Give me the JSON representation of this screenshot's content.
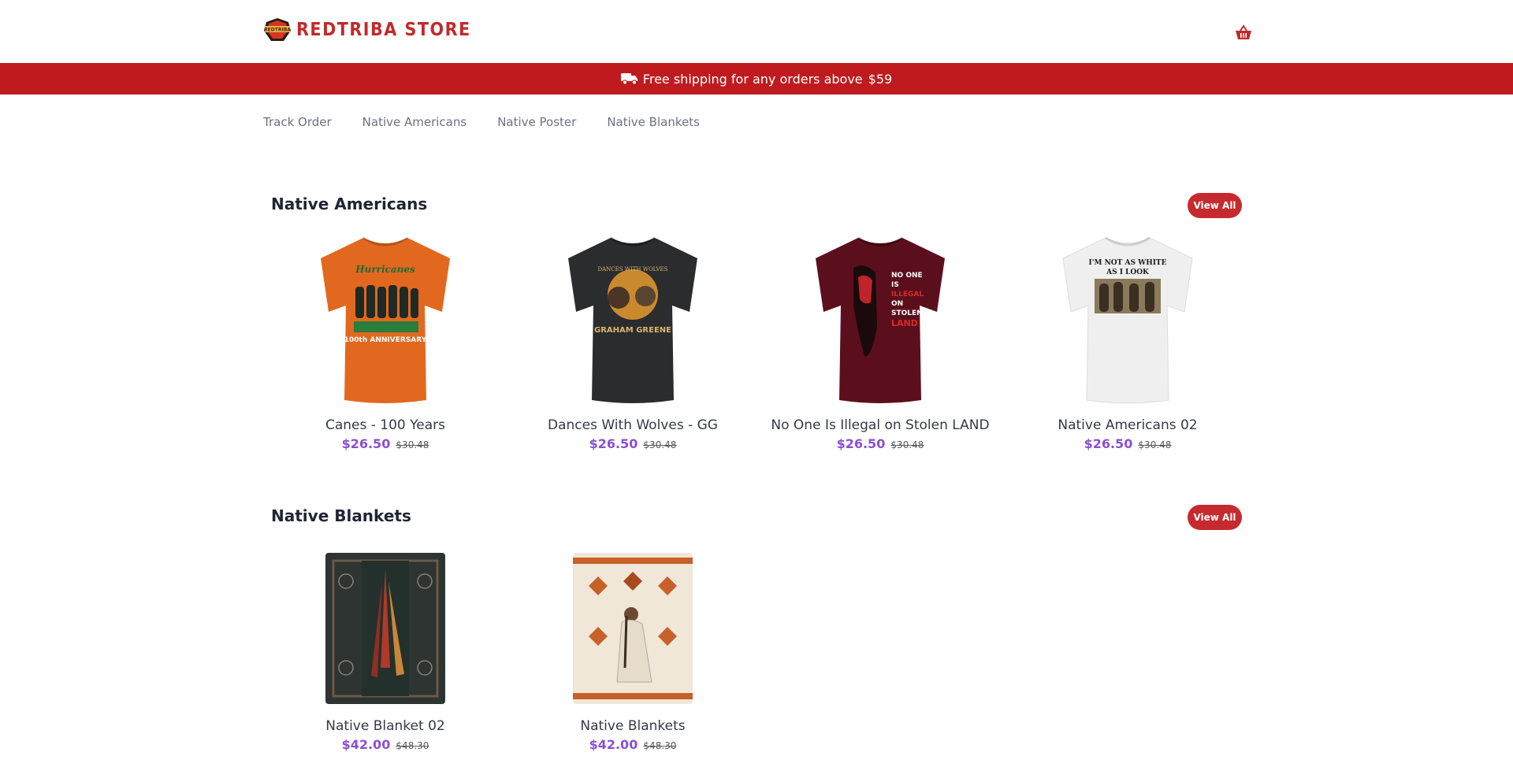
{
  "store": {
    "name": "REDTRIBA STORE",
    "badge_text": "REDTRIBA"
  },
  "banner": {
    "text": "Free shipping for any orders above",
    "amount": "$59"
  },
  "nav": [
    "Track Order",
    "Native Americans",
    "Native Poster",
    "Native Blankets"
  ],
  "sections": [
    {
      "title": "Native Americans",
      "view_all": "View All",
      "products": [
        {
          "name": "Canes - 100 Years",
          "price": "$26.50",
          "old_price": "$30.48",
          "shirt_color": "#e2681f",
          "print_text": "100th ANNIVERSARY"
        },
        {
          "name": "Dances With Wolves - GG",
          "price": "$26.50",
          "old_price": "$30.48",
          "shirt_color": "#2b2c2e",
          "print_text": "GRAHAM GREENE"
        },
        {
          "name": "No One Is Illegal on Stolen LAND",
          "price": "$26.50",
          "old_price": "$30.48",
          "shirt_color": "#5b0f1c",
          "print_text": "NO ONE IS ILLEGAL ON STOLEN LAND"
        },
        {
          "name": "Native Americans 02",
          "price": "$26.50",
          "old_price": "$30.48",
          "shirt_color": "#efefef",
          "print_text": "I'M NOT AS WHITE AS I LOOK"
        }
      ]
    },
    {
      "title": "Native Blankets",
      "view_all": "View All",
      "products": [
        {
          "name": "Native Blanket 02",
          "price": "$42.00",
          "old_price": "$48.30"
        },
        {
          "name": "Native Blankets",
          "price": "$42.00",
          "old_price": "$48.30"
        }
      ]
    }
  ],
  "colors": {
    "brand_red": "#bf1b1f",
    "button_red": "#c72a2e",
    "price_purple": "#8a4fd6"
  },
  "icons": [
    "store-logo-badge",
    "truck-icon",
    "shopping-basket-icon"
  ]
}
